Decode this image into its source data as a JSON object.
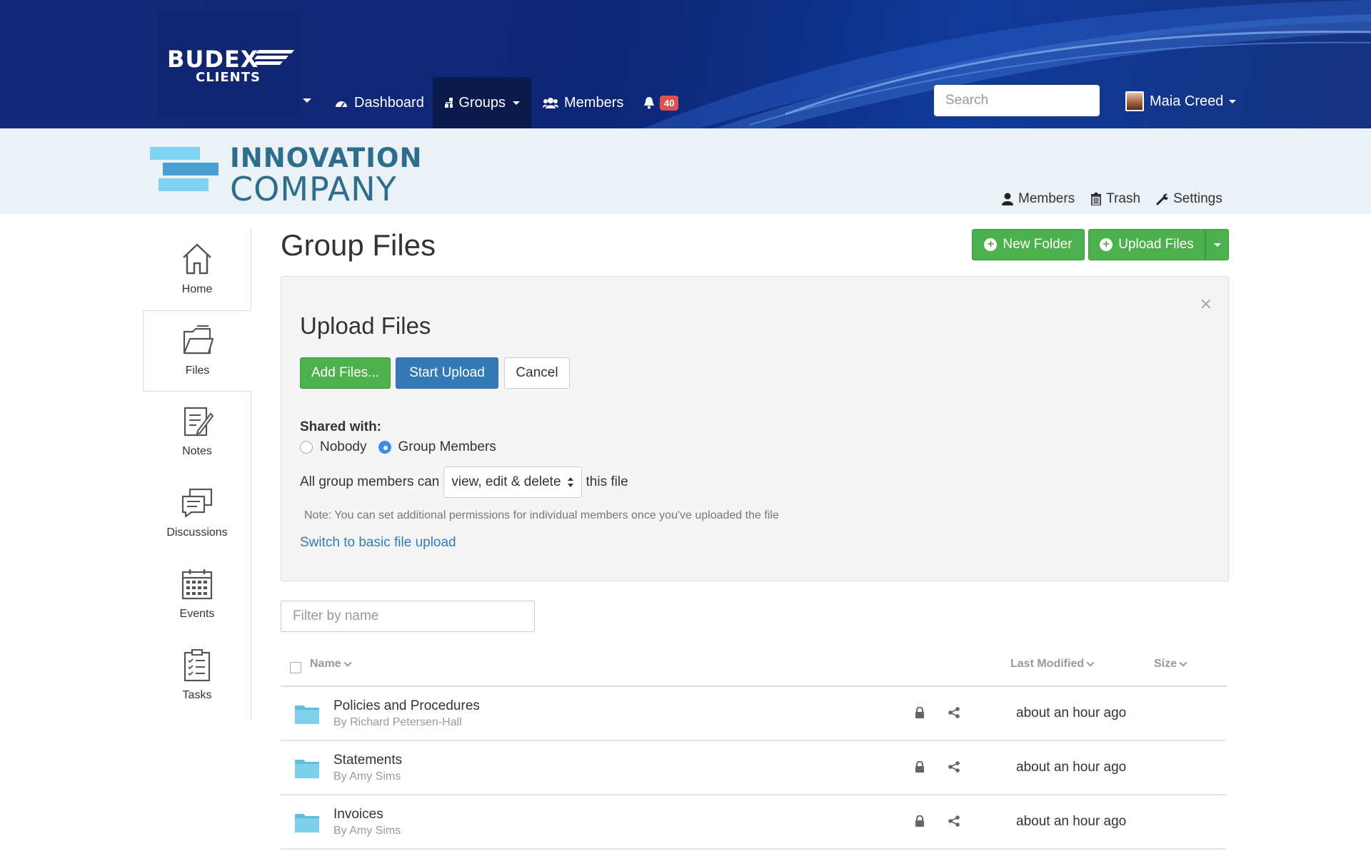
{
  "app": {
    "logo_main": "BUDEX",
    "logo_sub": "CLIENTS"
  },
  "nav": {
    "dashboard": "Dashboard",
    "groups": "Groups",
    "members": "Members",
    "notification_count": "40",
    "search_placeholder": "Search",
    "user_name": "Maia Creed"
  },
  "group": {
    "title_line1": "INNOVATION",
    "title_line2": "COMPANY",
    "links": {
      "members": "Members",
      "trash": "Trash",
      "settings": "Settings"
    }
  },
  "sidebar": {
    "items": [
      {
        "label": "Home",
        "icon": "home-icon"
      },
      {
        "label": "Files",
        "icon": "files-icon",
        "active": true
      },
      {
        "label": "Notes",
        "icon": "notes-icon"
      },
      {
        "label": "Discussions",
        "icon": "discussions-icon"
      },
      {
        "label": "Events",
        "icon": "calendar-icon"
      },
      {
        "label": "Tasks",
        "icon": "tasks-icon"
      }
    ]
  },
  "main": {
    "title": "Group Files",
    "new_folder": "New Folder",
    "upload_files": "Upload Files"
  },
  "upload_panel": {
    "title": "Upload Files",
    "add_files": "Add Files...",
    "start_upload": "Start Upload",
    "cancel": "Cancel",
    "shared_with_label": "Shared with:",
    "option_nobody": "Nobody",
    "option_group_members": "Group Members",
    "selected_option": "Group Members",
    "perm_prefix": "All group members can",
    "perm_value": "view, edit & delete",
    "perm_suffix": "this file",
    "note": "Note: You can set additional permissions for individual members once you've uploaded the file",
    "switch_link": "Switch to basic file upload"
  },
  "files": {
    "filter_placeholder": "Filter by name",
    "columns": {
      "name": "Name",
      "last_modified": "Last Modified",
      "size": "Size"
    },
    "rows": [
      {
        "name": "Policies and Procedures",
        "by": "By Richard Petersen-Hall",
        "modified": "about an hour ago"
      },
      {
        "name": "Statements",
        "by": "By Amy Sims",
        "modified": "about an hour ago"
      },
      {
        "name": "Invoices",
        "by": "By Amy Sims",
        "modified": "about an hour ago"
      }
    ]
  },
  "colors": {
    "nav_bg": "#142a78",
    "accent_green": "#4cb04c",
    "accent_blue": "#337ab7",
    "badge_red": "#d9534f",
    "group_title": "#2c6e8c",
    "folder": "#5bc0de"
  }
}
